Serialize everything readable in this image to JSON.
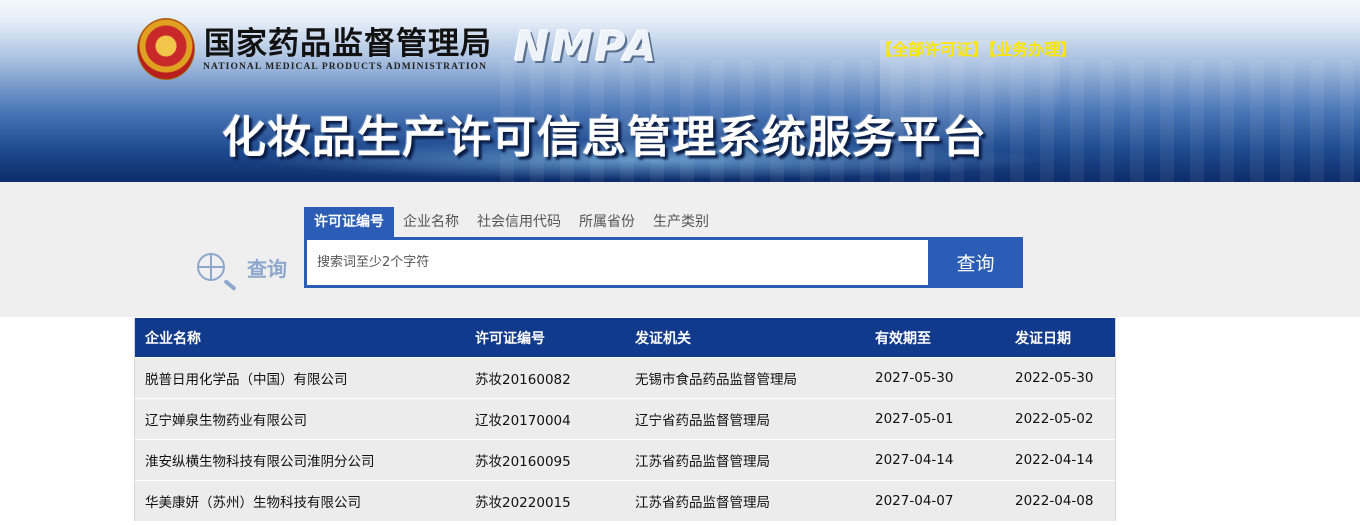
{
  "header": {
    "org_name_cn": "国家药品监督管理局",
    "org_name_en": "NATIONAL MEDICAL PRODUCTS ADMINISTRATION",
    "org_abbr": "NMPA",
    "link_all_licenses": "【全部许可证】",
    "link_business": "【业务办理】",
    "platform_title": "化妆品生产许可信息管理系统服务平台"
  },
  "search": {
    "label": "查询",
    "tabs": [
      {
        "label": "许可证编号",
        "active": true
      },
      {
        "label": "企业名称",
        "active": false
      },
      {
        "label": "社会信用代码",
        "active": false
      },
      {
        "label": "所属省份",
        "active": false
      },
      {
        "label": "生产类别",
        "active": false
      }
    ],
    "placeholder": "搜索词至少2个字符",
    "value": "",
    "button_label": "查询"
  },
  "table": {
    "columns": [
      "企业名称",
      "许可证编号",
      "发证机关",
      "有效期至",
      "发证日期"
    ],
    "rows": [
      [
        "脱普日用化学品（中国）有限公司",
        "苏妆20160082",
        "无锡市食品药品监督管理局",
        "2027-05-30",
        "2022-05-30"
      ],
      [
        "辽宁婵泉生物药业有限公司",
        "辽妆20170004",
        "辽宁省药品监督管理局",
        "2027-05-01",
        "2022-05-02"
      ],
      [
        "淮安纵横生物科技有限公司淮阴分公司",
        "苏妆20160095",
        "江苏省药品监督管理局",
        "2027-04-14",
        "2022-04-14"
      ],
      [
        "华美康妍（苏州）生物科技有限公司",
        "苏妆20220015",
        "江苏省药品监督管理局",
        "2027-04-07",
        "2022-04-08"
      ]
    ]
  },
  "colors": {
    "accent_blue": "#2b5db6",
    "table_header": "#123a8c",
    "link_yellow": "#ffe600"
  }
}
